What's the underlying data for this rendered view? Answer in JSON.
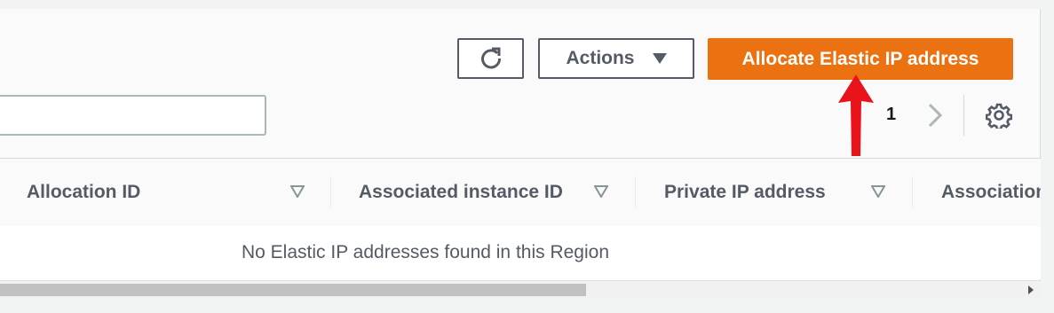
{
  "toolbar": {
    "refresh_icon": "refresh-icon",
    "actions_label": "Actions",
    "allocate_label": "Allocate Elastic IP address",
    "accent_color": "#ec7211"
  },
  "search": {
    "value": "",
    "placeholder": ""
  },
  "pagination": {
    "current_page": "1",
    "next_icon": "chevron-right-icon"
  },
  "settings_icon": "gear-icon",
  "table": {
    "columns": [
      {
        "label": "Allocation ID"
      },
      {
        "label": "Associated instance ID"
      },
      {
        "label": "Private IP address"
      },
      {
        "label": "Association"
      }
    ],
    "empty_message": "No Elastic IP addresses found in this Region"
  },
  "annotation": {
    "icon": "red-arrow-up-icon",
    "color": "#e8131b"
  }
}
